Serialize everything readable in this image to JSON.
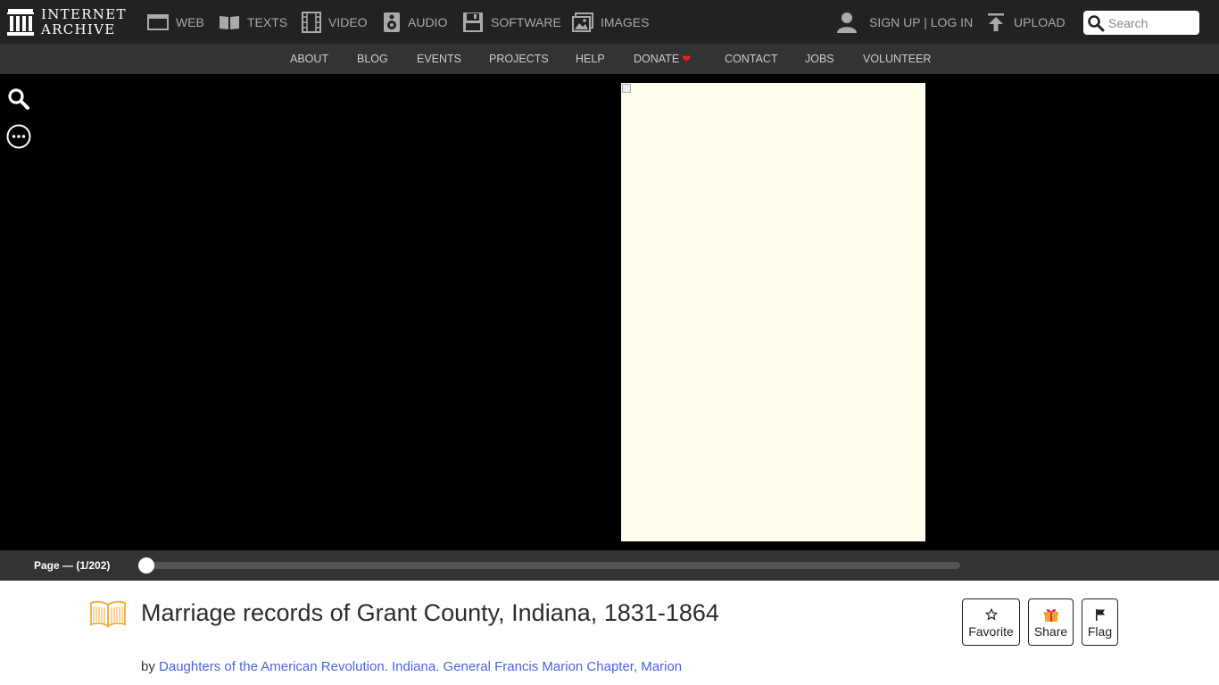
{
  "header": {
    "logo": {
      "line1": "INTERNET",
      "line2": "ARCHIVE",
      "icon": "archive-building-icon"
    },
    "media_types": [
      {
        "label": "WEB",
        "icon": "web-window-icon"
      },
      {
        "label": "TEXTS",
        "icon": "open-book-icon"
      },
      {
        "label": "VIDEO",
        "icon": "film-strip-icon"
      },
      {
        "label": "AUDIO",
        "icon": "speaker-icon"
      },
      {
        "label": "SOFTWARE",
        "icon": "floppy-disk-icon"
      },
      {
        "label": "IMAGES",
        "icon": "image-icon"
      }
    ],
    "account": {
      "label": "SIGN UP | LOG IN",
      "icon": "user-icon"
    },
    "upload": {
      "label": "UPLOAD",
      "icon": "upload-arrow-icon"
    },
    "search": {
      "placeholder": "Search",
      "icon": "search-icon"
    },
    "colors": {
      "bar": "#222222",
      "text": "#aaaaaa"
    }
  },
  "subnav": {
    "items": [
      "ABOUT",
      "BLOG",
      "EVENTS",
      "PROJECTS",
      "HELP",
      "DONATE",
      "CONTACT",
      "JOBS",
      "VOLUNTEER"
    ],
    "donate_icon": "heart-icon",
    "heart_color": "#ef1e1e"
  },
  "reader": {
    "tools": [
      {
        "name": "search-icon"
      },
      {
        "name": "more-options-icon"
      }
    ],
    "page_background": "#fffeec"
  },
  "navbar": {
    "page_label": "Page — (1/202)",
    "current_page": 1,
    "total_pages": 202
  },
  "item": {
    "icon": "open-book-icon",
    "title": "Marriage records of Grant County, Indiana, 1831-1864",
    "by_label": "by",
    "creator": "Daughters of the American Revolution. Indiana. General Francis Marion Chapter, Marion",
    "link_color": "#4b64dc"
  },
  "actions": [
    {
      "label": "Favorite",
      "icon": "star-icon"
    },
    {
      "label": "Share",
      "icon": "gift-icon"
    },
    {
      "label": "Flag",
      "icon": "flag-icon"
    }
  ]
}
